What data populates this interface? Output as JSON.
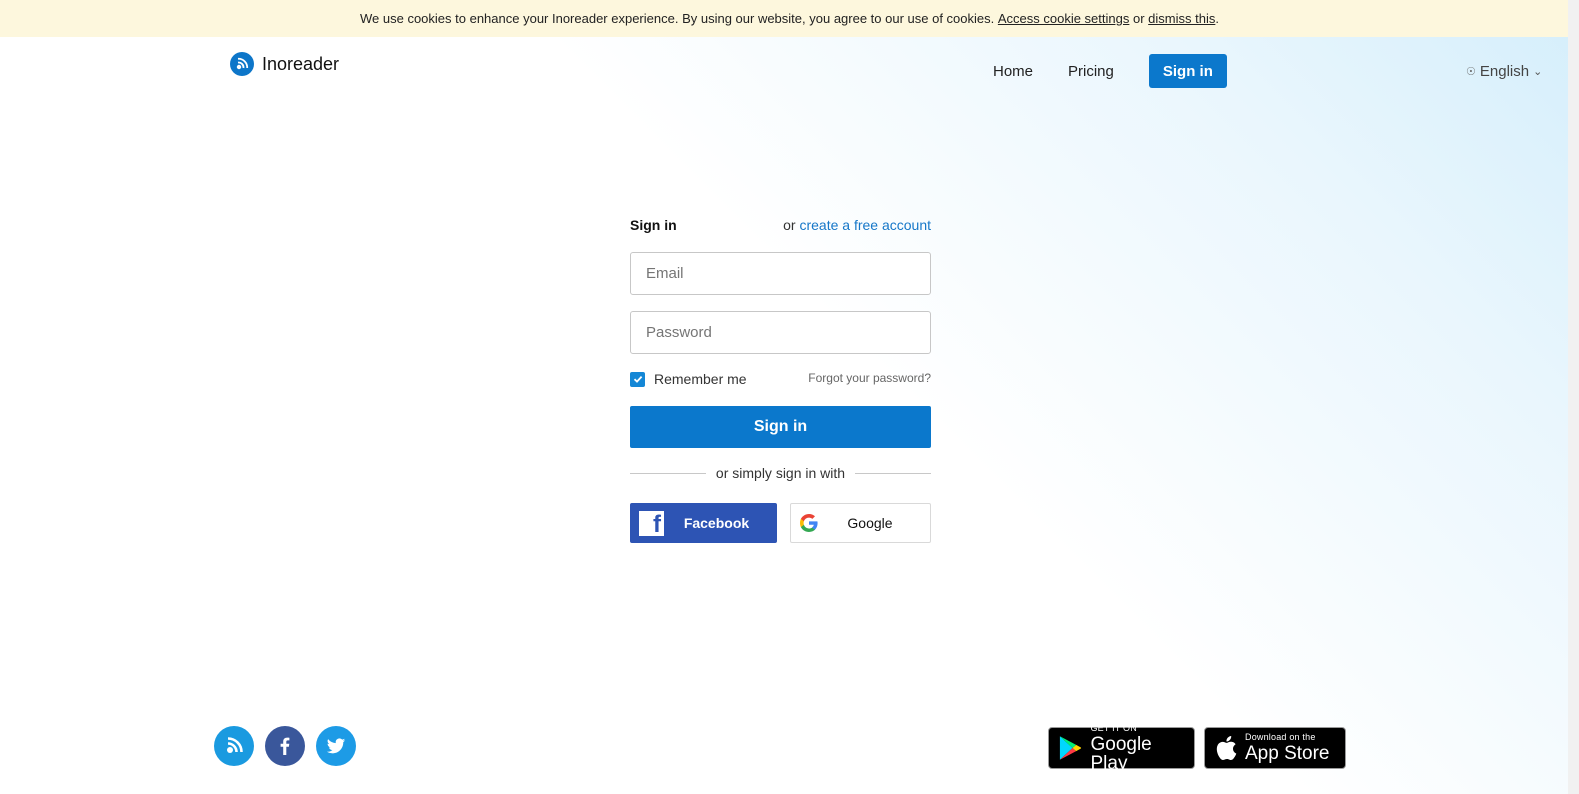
{
  "cookie_bar": {
    "text_before": "We use cookies to enhance your Inoreader experience. By using our website, you agree to our use of cookies. ",
    "settings_link": "Access cookie settings",
    "text_between": " or ",
    "dismiss_link": "dismiss this",
    "text_after": "."
  },
  "brand": {
    "name": "Inoreader"
  },
  "nav": {
    "home": "Home",
    "pricing": "Pricing",
    "sign_in": "Sign in"
  },
  "language": {
    "label": "English"
  },
  "form": {
    "title": "Sign in",
    "or_text": "or ",
    "create_account": "create a free account",
    "email_placeholder": "Email",
    "password_placeholder": "Password",
    "remember_me": "Remember me",
    "remember_checked": true,
    "forgot": "Forgot your password?",
    "submit": "Sign in",
    "divider": "or simply sign in with",
    "facebook": "Facebook",
    "google": "Google"
  },
  "stores": {
    "google_small": "GET IT ON",
    "google_big": "Google Play",
    "apple_small": "Download on the",
    "apple_big": "App Store"
  },
  "colors": {
    "primary": "#0b78cc",
    "facebook": "#2d54b4",
    "cookie_bg": "#fdf7dd"
  }
}
